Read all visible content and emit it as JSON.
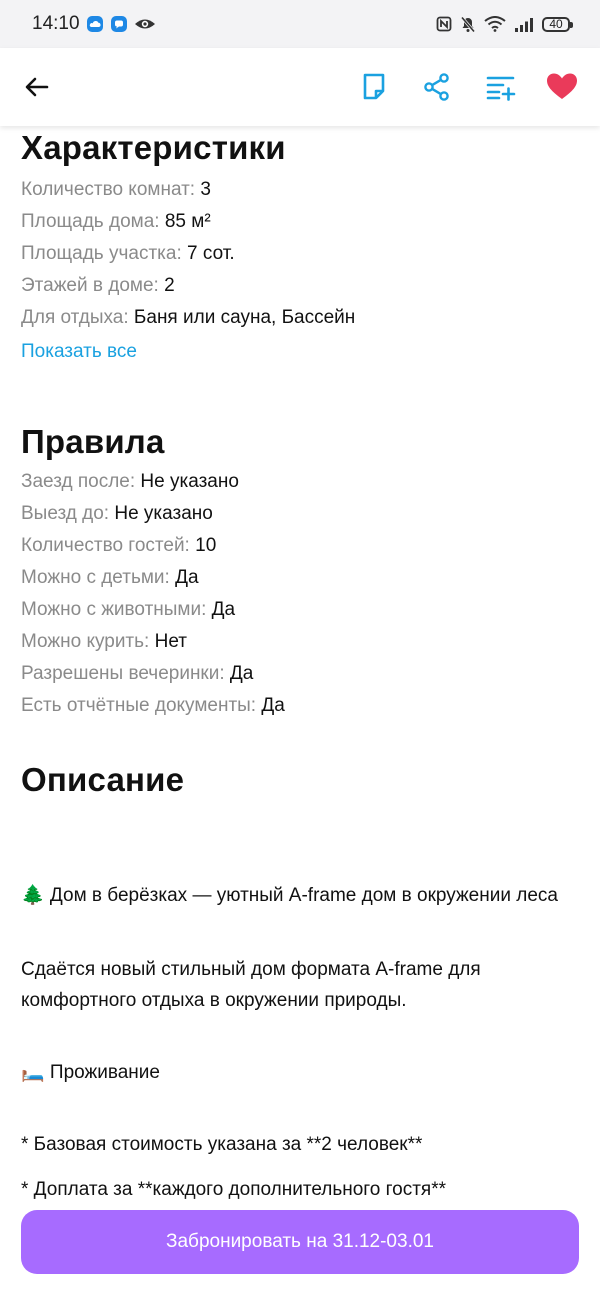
{
  "status_bar": {
    "time": "14:10",
    "battery": "40",
    "icons": [
      "cloud-icon",
      "chat-icon",
      "eye-icon",
      "nfc-icon",
      "mute-icon",
      "wifi-icon",
      "signal-icon"
    ]
  },
  "toolbar": {
    "icons": [
      "arrow-left-icon",
      "note-icon",
      "share-icon",
      "compare-icon",
      "heart-icon"
    ],
    "accent_color": "#1aa1e0",
    "favorite_color": "#ea3a5a"
  },
  "characteristics": {
    "title": "Характеристики",
    "rows": [
      {
        "label": "Количество комнат:",
        "value": "3"
      },
      {
        "label": "Площадь дома:",
        "value": "85 м²"
      },
      {
        "label": "Площадь участка:",
        "value": "7 сот."
      },
      {
        "label": "Этажей в доме:",
        "value": "2"
      },
      {
        "label": "Для отдыха:",
        "value": "Баня или сауна, Бассейн"
      }
    ],
    "show_all": "Показать все"
  },
  "rules": {
    "title": "Правила",
    "rows": [
      {
        "label": "Заезд после:",
        "value": "Не указано"
      },
      {
        "label": "Выезд до:",
        "value": "Не указано"
      },
      {
        "label": "Количество гостей:",
        "value": "10"
      },
      {
        "label": "Можно с детьми:",
        "value": "Да"
      },
      {
        "label": "Можно с животными:",
        "value": "Да"
      },
      {
        "label": "Можно курить:",
        "value": "Нет"
      },
      {
        "label": "Разрешены вечеринки:",
        "value": "Да"
      },
      {
        "label": "Есть отчётные документы:",
        "value": "Да"
      }
    ]
  },
  "description": {
    "title": "Описание",
    "headline": "🌲 Дом в берёзках — уютный A-frame дом в окружении леса",
    "intro": "Сдаётся новый стильный дом формата A-frame для комфортного отдыха в окружении природы.",
    "living_heading": "🛏️ Проживание",
    "bullet_1": "* Базовая стоимость указана за **2 человек**",
    "bullet_2": "* Доплата за **каждого дополнительного гостя**"
  },
  "booking": {
    "button_label": "Забронировать на 31.12-03.01",
    "button_color": "#a76bff"
  }
}
